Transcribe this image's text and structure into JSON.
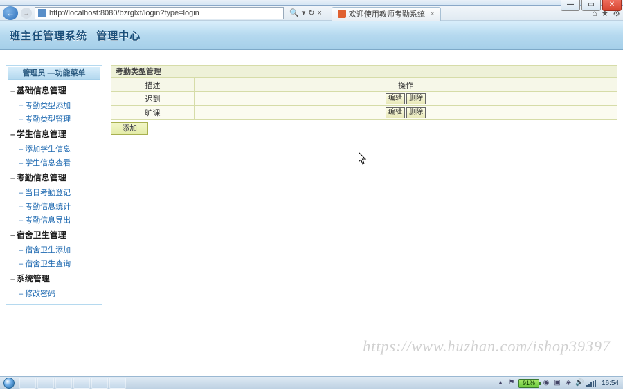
{
  "window": {
    "url": "http://localhost:8080/bzrglxt/login?type=login",
    "tab_title": "欢迎使用教师考勤系统",
    "refresh_glyph": "↻",
    "stop_glyph": "×",
    "search_glyph": "🔍"
  },
  "app": {
    "title_main": "班主任管理系统",
    "title_sub": "管理中心"
  },
  "sidebar": {
    "title": "管理员 —功能菜单",
    "groups": [
      {
        "label": "基础信息管理",
        "items": [
          "考勤类型添加",
          "考勤类型管理"
        ]
      },
      {
        "label": "学生信息管理",
        "items": [
          "添加学生信息",
          "学生信息查看"
        ]
      },
      {
        "label": "考勤信息管理",
        "items": [
          "当日考勤登记",
          "考勤信息统计",
          "考勤信息导出"
        ]
      },
      {
        "label": "宿舍卫生管理",
        "items": [
          "宿舍卫生添加",
          "宿舍卫生查询"
        ]
      },
      {
        "label": "系统管理",
        "items": [
          "修改密码"
        ]
      }
    ]
  },
  "content": {
    "panel_title": "考勤类型管理",
    "columns": {
      "desc": "描述",
      "op": "操作"
    },
    "rows": [
      {
        "desc": "迟到"
      },
      {
        "desc": "旷课"
      }
    ],
    "buttons": {
      "edit": "编辑",
      "delete": "删除",
      "add": "添加"
    }
  },
  "taskbar": {
    "battery": "91%",
    "clock": "16:54"
  },
  "watermark": "https://www.huzhan.com/ishop39397"
}
